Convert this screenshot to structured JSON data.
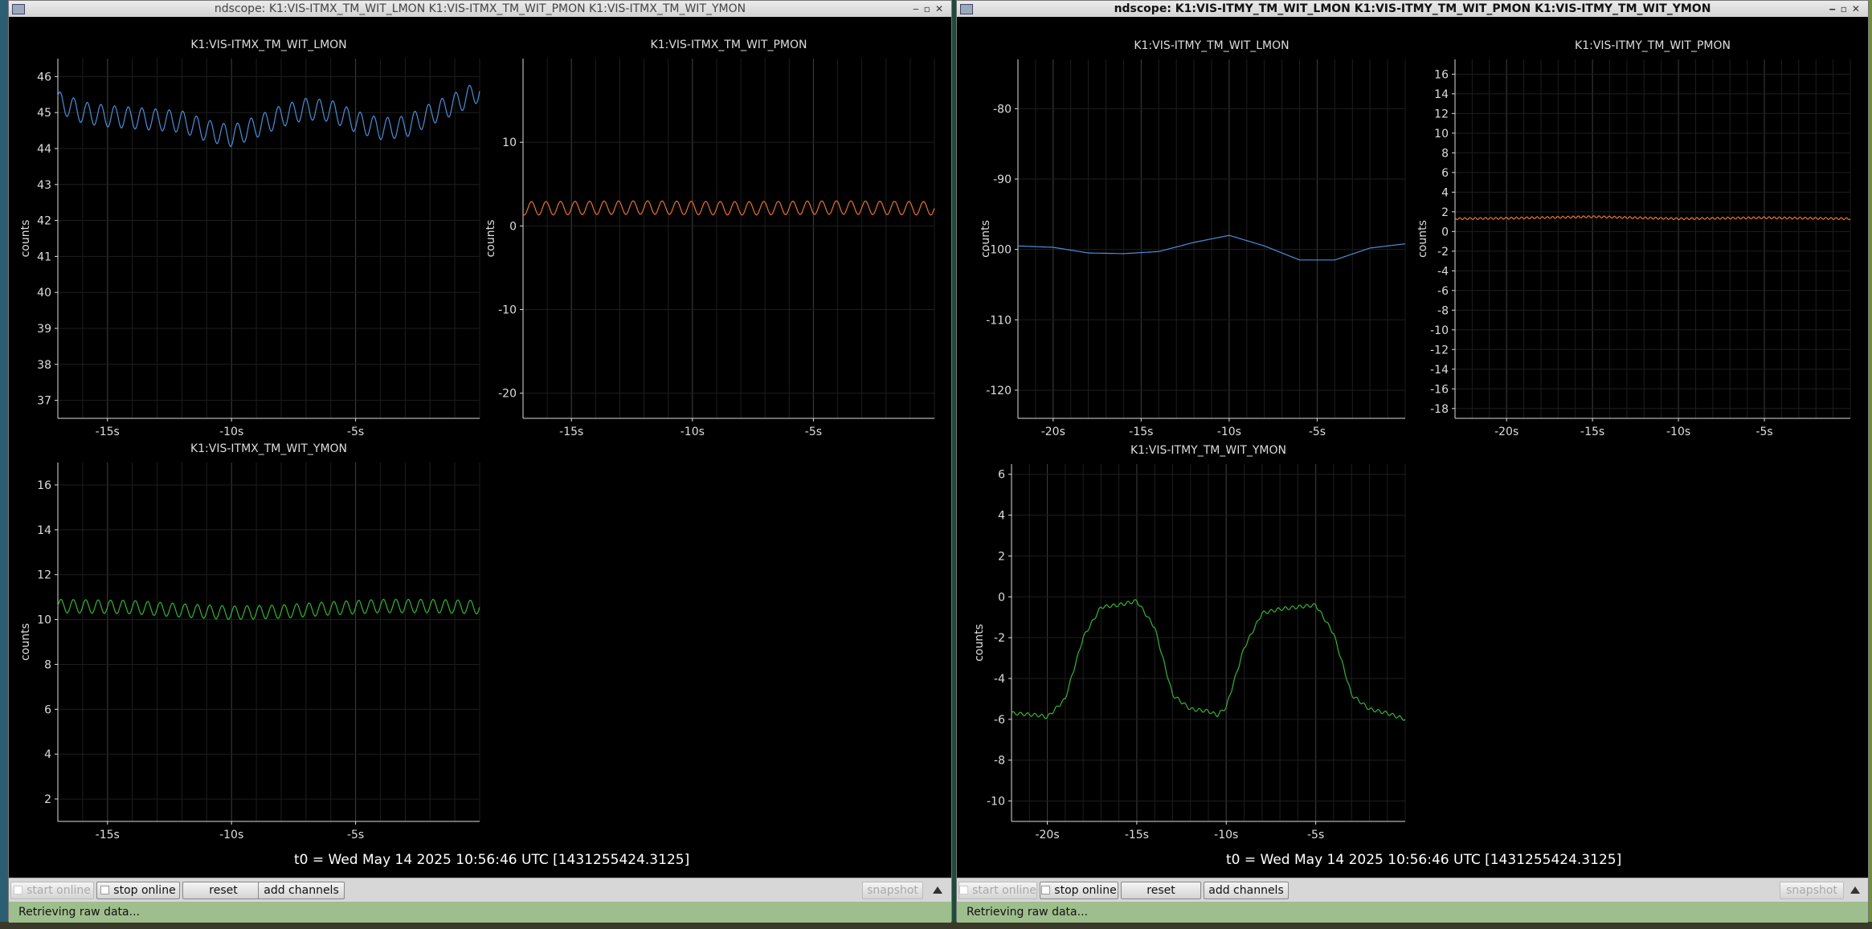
{
  "windows": [
    {
      "id": "left",
      "title": "ndscope: K1:VIS-ITMX_TM_WIT_LMON K1:VIS-ITMX_TM_WIT_PMON K1:VIS-ITMX_TM_WIT_YMON",
      "t0_label": "t0 = Wed May 14 2025 10:56:46 UTC [1431255424.3125]",
      "buttons": {
        "start_online": "start online",
        "stop_online": "stop online",
        "reset": "reset",
        "add_channels": "add channels",
        "snapshot": "snapshot"
      },
      "status": "Retrieving raw data..."
    },
    {
      "id": "right",
      "title": "ndscope: K1:VIS-ITMY_TM_WIT_LMON K1:VIS-ITMY_TM_WIT_PMON K1:VIS-ITMY_TM_WIT_YMON",
      "t0_label": "t0 = Wed May 14 2025 10:56:46 UTC [1431255424.3125]",
      "buttons": {
        "start_online": "start online",
        "stop_online": "stop online",
        "reset": "reset",
        "add_channels": "add channels",
        "snapshot": "snapshot"
      },
      "status": "Retrieving raw data..."
    }
  ],
  "chart_data": [
    {
      "type": "line",
      "window": "left",
      "title": "K1:VIS-ITMX_TM_WIT_LMON",
      "ylabel": "counts",
      "color": "#4a90d9",
      "xlim": [
        -17,
        0
      ],
      "ylim": [
        36.5,
        46.5
      ],
      "yticks": [
        37,
        38,
        39,
        40,
        41,
        42,
        43,
        44,
        45,
        46
      ],
      "xticks": [
        -15,
        -10,
        -5
      ],
      "xtick_labels": [
        "-15s",
        "-10s",
        "-5s"
      ],
      "x": [
        -17,
        -16,
        -15,
        -14,
        -13,
        -12,
        -11,
        -10,
        -9,
        -8,
        -7,
        -6,
        -5,
        -4,
        -3,
        -2,
        -1,
        0
      ],
      "y": [
        45.3,
        45.0,
        44.9,
        44.85,
        44.8,
        44.75,
        44.5,
        44.35,
        44.6,
        44.9,
        45.1,
        45.05,
        44.75,
        44.55,
        44.6,
        44.95,
        45.25,
        45.6
      ],
      "osc_amplitude": 0.3,
      "osc_period": 0.55
    },
    {
      "type": "line",
      "window": "left",
      "title": "K1:VIS-ITMX_TM_WIT_PMON",
      "ylabel": "counts",
      "color": "#e8742a",
      "xlim": [
        -17,
        0
      ],
      "ylim": [
        -23,
        20
      ],
      "yticks": [
        -20,
        -10,
        0,
        10
      ],
      "xticks": [
        -15,
        -10,
        -5
      ],
      "xtick_labels": [
        "-15s",
        "-10s",
        "-5s"
      ],
      "x": [
        -17,
        -12,
        -8,
        -4,
        0
      ],
      "y": [
        2.1,
        2.2,
        2.1,
        2.2,
        2.1
      ],
      "osc_amplitude": 0.8,
      "osc_period": 0.6
    },
    {
      "type": "line",
      "window": "left",
      "title": "K1:VIS-ITMX_TM_WIT_YMON",
      "ylabel": "counts",
      "color": "#35b535",
      "xlim": [
        -17,
        0
      ],
      "ylim": [
        1,
        17
      ],
      "yticks": [
        2,
        4,
        6,
        8,
        10,
        12,
        14,
        16
      ],
      "xticks": [
        -15,
        -10,
        -5
      ],
      "xtick_labels": [
        "-15s",
        "-10s",
        "-5s"
      ],
      "x": [
        -17,
        -14,
        -12,
        -10,
        -8,
        -6,
        -4,
        -2,
        0
      ],
      "y": [
        10.6,
        10.55,
        10.4,
        10.3,
        10.35,
        10.5,
        10.6,
        10.6,
        10.55
      ],
      "osc_amplitude": 0.3,
      "osc_period": 0.5
    },
    {
      "type": "line",
      "window": "right",
      "title": "K1:VIS-ITMY_TM_WIT_LMON",
      "ylabel": "counts",
      "color": "#4a90d9",
      "xlim": [
        -22,
        0
      ],
      "ylim": [
        -124,
        -73
      ],
      "yticks": [
        -120,
        -110,
        -100,
        -90,
        -80
      ],
      "xticks": [
        -20,
        -15,
        -10,
        -5
      ],
      "xtick_labels": [
        "-20s",
        "-15s",
        "-10s",
        "-5s"
      ],
      "x": [
        -22,
        -20,
        -18,
        -16,
        -14,
        -12,
        -10,
        -8,
        -6,
        -4,
        -2,
        0
      ],
      "y": [
        -99.5,
        -99.7,
        -100.5,
        -100.6,
        -100.3,
        -99.0,
        -98.0,
        -99.5,
        -101.5,
        -101.5,
        -99.8,
        -99.2
      ],
      "osc_amplitude": 0,
      "osc_period": 1
    },
    {
      "type": "line",
      "window": "right",
      "title": "K1:VIS-ITMY_TM_WIT_PMON",
      "ylabel": "counts",
      "color": "#e8742a",
      "xlim": [
        -23,
        0
      ],
      "ylim": [
        -19,
        17.5
      ],
      "yticks": [
        -18,
        -16,
        -14,
        -12,
        -10,
        -8,
        -6,
        -4,
        -2,
        0,
        2,
        4,
        6,
        8,
        10,
        12,
        14,
        16
      ],
      "xticks": [
        -20,
        -15,
        -10,
        -5
      ],
      "xtick_labels": [
        "-20s",
        "-15s",
        "-10s",
        "-5s"
      ],
      "x": [
        -23,
        -20,
        -15,
        -10,
        -5,
        0
      ],
      "y": [
        1.3,
        1.35,
        1.5,
        1.3,
        1.4,
        1.3
      ],
      "osc_amplitude": 0.1,
      "osc_period": 0.3
    },
    {
      "type": "line",
      "window": "right",
      "title": "K1:VIS-ITMY_TM_WIT_YMON",
      "ylabel": "counts",
      "color": "#35b535",
      "xlim": [
        -22,
        0
      ],
      "ylim": [
        -11,
        6.5
      ],
      "yticks": [
        -10,
        -8,
        -6,
        -4,
        -2,
        0,
        2,
        4,
        6
      ],
      "xticks": [
        -20,
        -15,
        -10,
        -5
      ],
      "xtick_labels": [
        "-20s",
        "-15s",
        "-10s",
        "-5s"
      ],
      "x": [
        -22,
        -20.5,
        -20,
        -19,
        -18,
        -17,
        -16,
        -15,
        -14,
        -13,
        -12,
        -11,
        -10.5,
        -10,
        -9,
        -8,
        -7,
        -6,
        -5,
        -4,
        -3,
        -2,
        -1,
        0
      ],
      "y": [
        -5.7,
        -5.8,
        -5.9,
        -5.0,
        -2.0,
        -0.5,
        -0.4,
        -0.2,
        -1.5,
        -4.8,
        -5.5,
        -5.6,
        -5.8,
        -5.4,
        -2.5,
        -0.8,
        -0.6,
        -0.5,
        -0.4,
        -1.8,
        -4.8,
        -5.5,
        -5.7,
        -6.0
      ],
      "osc_amplitude": 0.08,
      "osc_period": 0.4
    }
  ]
}
